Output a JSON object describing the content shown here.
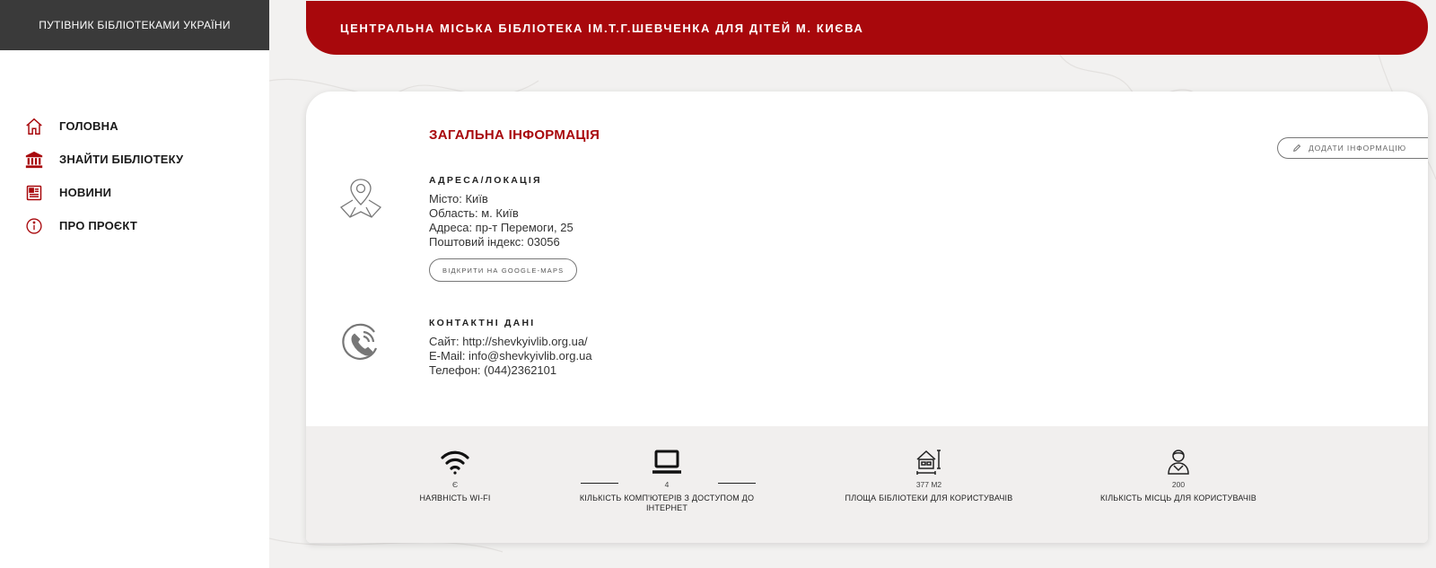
{
  "sidebar": {
    "brand": "ПУТІВНИК БІБЛІОТЕКАМИ УКРАЇНИ",
    "items": [
      {
        "label": "ГОЛОВНА",
        "icon": "home-icon"
      },
      {
        "label": "ЗНАЙТИ БІБЛІОТЕКУ",
        "icon": "library-building-icon"
      },
      {
        "label": "НОВИНИ",
        "icon": "newspaper-icon"
      },
      {
        "label": "ПРО ПРОЄКТ",
        "icon": "info-icon"
      }
    ]
  },
  "header": {
    "title": "ЦЕНТРАЛЬНА МІСЬКА БІБЛІОТЕКА ІМ.Т.Г.ШЕВЧЕНКА ДЛЯ ДІТЕЙ М. КИЄВА"
  },
  "main": {
    "section_title": "ЗАГАЛЬНА ІНФОРМАЦІЯ",
    "add_info_label": "ДОДАТИ ІНФОРМАЦІЮ",
    "address": {
      "heading": "АДРЕСА/ЛОКАЦІЯ",
      "city": "Місто: Київ",
      "region": "Область: м. Київ",
      "street": "Адреса: пр-т Перемоги, 25",
      "postcode": "Поштовий індекс: 03056",
      "maps_button": "ВІДКРИТИ НА GOOGLE-MAPS"
    },
    "contacts": {
      "heading": "КОНТАКТНІ ДАНІ",
      "site": "Сайт: http://shevkyivlib.org.ua/",
      "email": "E-Mail: info@shevkyivlib.org.ua",
      "phone": "Телефон: (044)2362101"
    }
  },
  "stats": [
    {
      "icon": "wifi-icon",
      "value": "Є",
      "label": "НАЯВНІСТЬ WI-FI"
    },
    {
      "icon": "laptop-icon",
      "value": "4",
      "label": "КІЛЬКІСТЬ КОМП'ЮТЕРІВ З ДОСТУПОМ ДО ІНТЕРНЕТ"
    },
    {
      "icon": "library-area-icon",
      "value": "377 М2",
      "label": "ПЛОЩА БІБЛІОТЕКИ ДЛЯ КОРИСТУВАЧІВ"
    },
    {
      "icon": "user-seat-icon",
      "value": "200",
      "label": "КІЛЬКІСТЬ МІСЦЬ ДЛЯ КОРИСТУВАЧІВ"
    }
  ],
  "colors": {
    "accent": "#a8080c",
    "brand_bar": "#3a3a3a",
    "stats_bg": "#f1efee"
  }
}
